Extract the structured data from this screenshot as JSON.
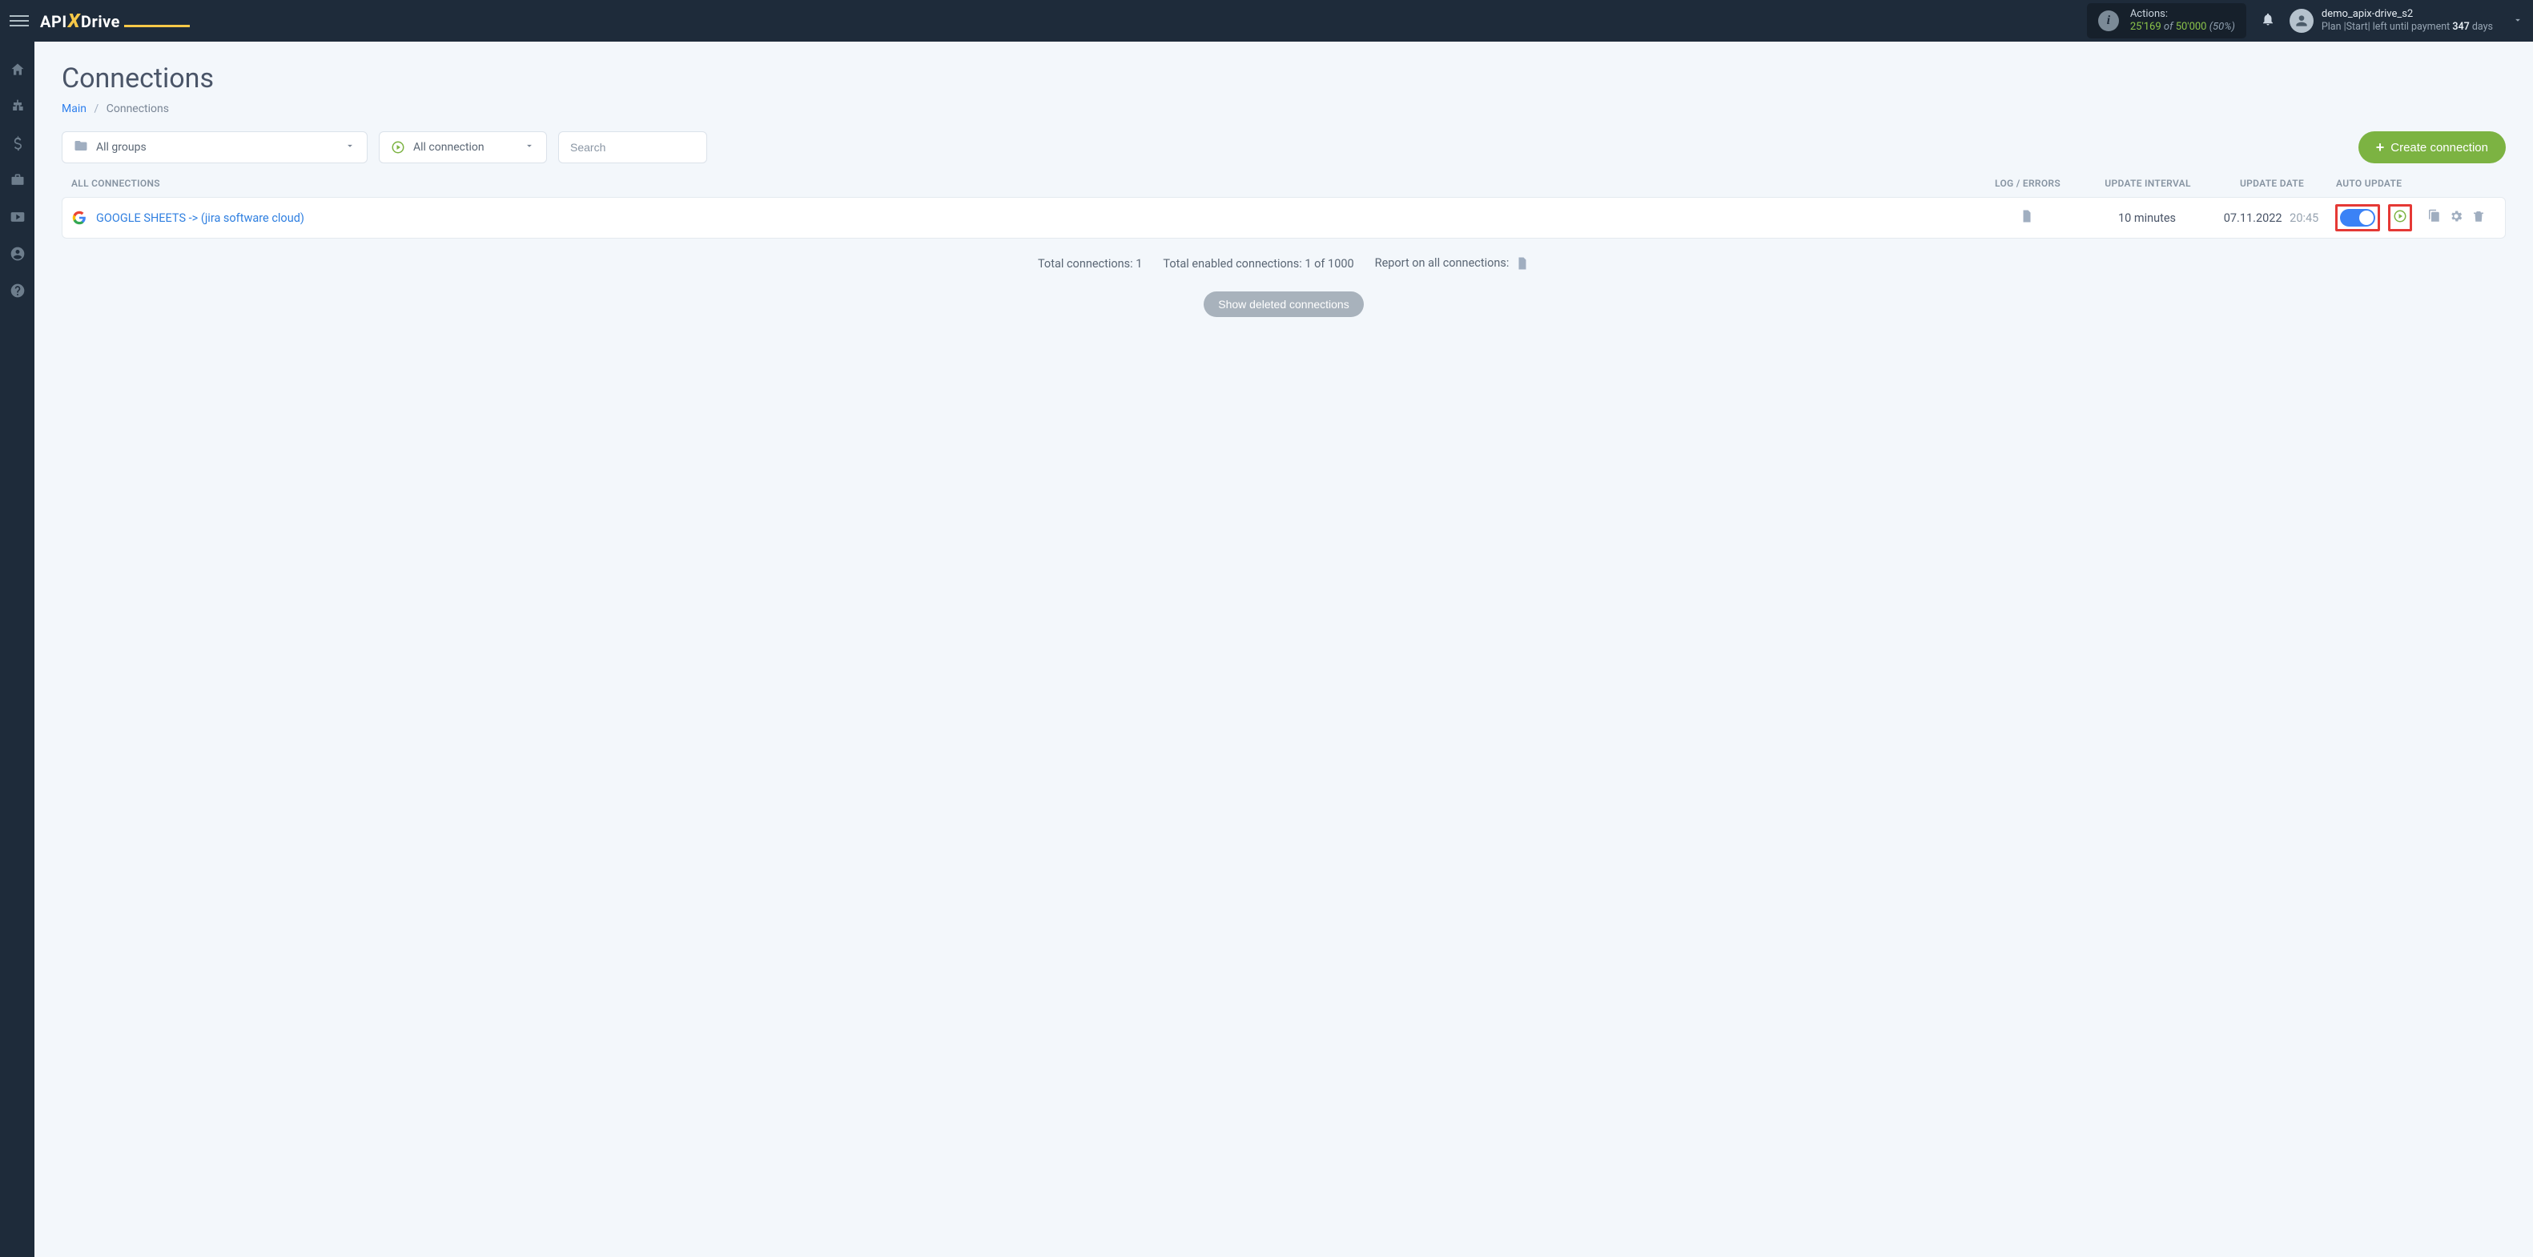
{
  "header": {
    "actions_label": "Actions:",
    "actions_used": "25'169",
    "actions_of": "of",
    "actions_total": "50'000",
    "actions_pct": "(50%)",
    "user_name": "demo_apix-drive_s2",
    "plan_prefix": "Plan |Start| left until payment ",
    "plan_days_num": "347",
    "plan_days_suffix": " days"
  },
  "page": {
    "title": "Connections",
    "breadcrumb_main": "Main",
    "breadcrumb_current": "Connections"
  },
  "filters": {
    "groups": "All groups",
    "connection": "All connection",
    "search_placeholder": "Search",
    "create_button": "Create connection"
  },
  "columns": {
    "all": "ALL CONNECTIONS",
    "log": "LOG / ERRORS",
    "interval": "UPDATE INTERVAL",
    "date": "UPDATE DATE",
    "auto": "AUTO UPDATE"
  },
  "row": {
    "name": "GOOGLE SHEETS -> (jira software cloud)",
    "interval": "10 minutes",
    "date": "07.11.2022",
    "time": "20:45"
  },
  "summary": {
    "total": "Total connections: 1",
    "enabled": "Total enabled connections: 1 of 1000",
    "report": "Report on all connections:"
  },
  "deleted_button": "Show deleted connections"
}
